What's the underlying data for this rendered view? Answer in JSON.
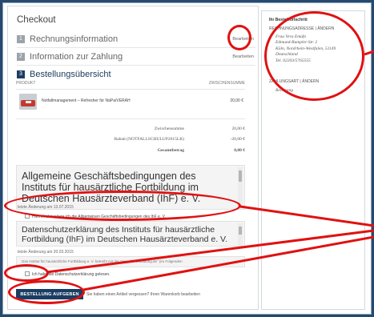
{
  "checkout": {
    "title": "Checkout",
    "steps": [
      {
        "num": "1",
        "label": "Rechnungsinformation",
        "edit": "Bearbeiten"
      },
      {
        "num": "2",
        "label": "Information zur Zahlung",
        "edit": "Bearbeiten"
      },
      {
        "num": "3",
        "label": "Bestellungsübersicht"
      }
    ]
  },
  "table": {
    "col_product": "PRODUKT",
    "col_subtotal": "ZWISCHENSUMME",
    "item_name": "Notfallmanagement – Refresher für NäPa/VERAH",
    "item_price": "20,00 €"
  },
  "summary": [
    {
      "label": "Zwischensumme",
      "value": "20,00 €"
    },
    {
      "label": "Rabatt (NOTFALLSCHULUP2015LK)",
      "value": "-20,00 €"
    },
    {
      "label": "Gesamtbetrag",
      "value": "0,00 €"
    }
  ],
  "agb": {
    "text": "Allgemeine Geschäftsbedingungen des Instituts für hausärztliche Fortbildung im Deutschen Hausärzteverband (IhF) e. V.",
    "changed": "letzte Änderung am 13.07.2015",
    "accept_label": "Hiermit akzeptiere ich die Allgemeinen Geschäftsbedingungen des IhF e. V."
  },
  "privacy": {
    "text": "Datenschutzerklärung des Instituts für hausärztliche Fortbildung (IhF) im Deutschen Hausärzteverband e. V.",
    "changed": "letzte Änderung am 20.03.2015",
    "sub": "Das Institut für hausärztliche Fortbildung e. V. betreibt mit der \"www.ihf-fortbildung.de\" (im Folgenden",
    "accept_label": "Ich habe die Datenschutzerklärung gelesen."
  },
  "actions": {
    "submit": "BESTELLUNG AUFGEBEN",
    "after": "Sie haben einen Artikel vergessen? Ihren Warenkorb bearbeiten"
  },
  "sidebar": {
    "heading": "Ihr Bestellfortschritt",
    "billing_heading": "RECHNUNGSADRESSE | ÄNDERN",
    "address": [
      "Frau Vera Emafo",
      "Edmund-Rumpler-Str. 2",
      "Köln, Nordrhein-Westfalen, 51149",
      "Deutschland",
      "Tel. 02203/5765555"
    ],
    "payment_heading": "ZAHLUNGSART | ÄNDERN",
    "payment_method": "Rechnung"
  },
  "colors": {
    "accent": "#1b3d63",
    "annotation": "#e01111",
    "frame_bg": "#27496f"
  }
}
